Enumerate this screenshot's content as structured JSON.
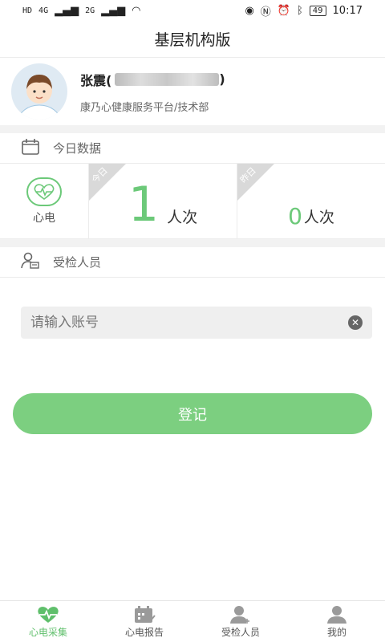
{
  "status": {
    "left": [
      "HD",
      "4G",
      "2G"
    ],
    "battery": "49",
    "time": "10:17"
  },
  "header": {
    "title": "基层机构版"
  },
  "profile": {
    "name": "张震(",
    "name_suffix": ")",
    "org": "康乃心健康服务平台/技术部"
  },
  "today_section": {
    "title": "今日数据"
  },
  "stats": {
    "type_label": "心电",
    "today": {
      "corner": "今日",
      "value": "1",
      "unit": "人次"
    },
    "yesterday": {
      "corner": "昨日",
      "value": "0",
      "unit": "人次"
    }
  },
  "examinee_section": {
    "title": "受检人员"
  },
  "account_input": {
    "placeholder": "请输入账号",
    "value": ""
  },
  "register_button": {
    "label": "登记"
  },
  "tabs": [
    {
      "label": "心电采集",
      "active": true
    },
    {
      "label": "心电报告",
      "active": false
    },
    {
      "label": "受检人员",
      "active": false
    },
    {
      "label": "我的",
      "active": false
    }
  ],
  "colors": {
    "accent": "#6cc979",
    "button": "#7ccf80"
  }
}
